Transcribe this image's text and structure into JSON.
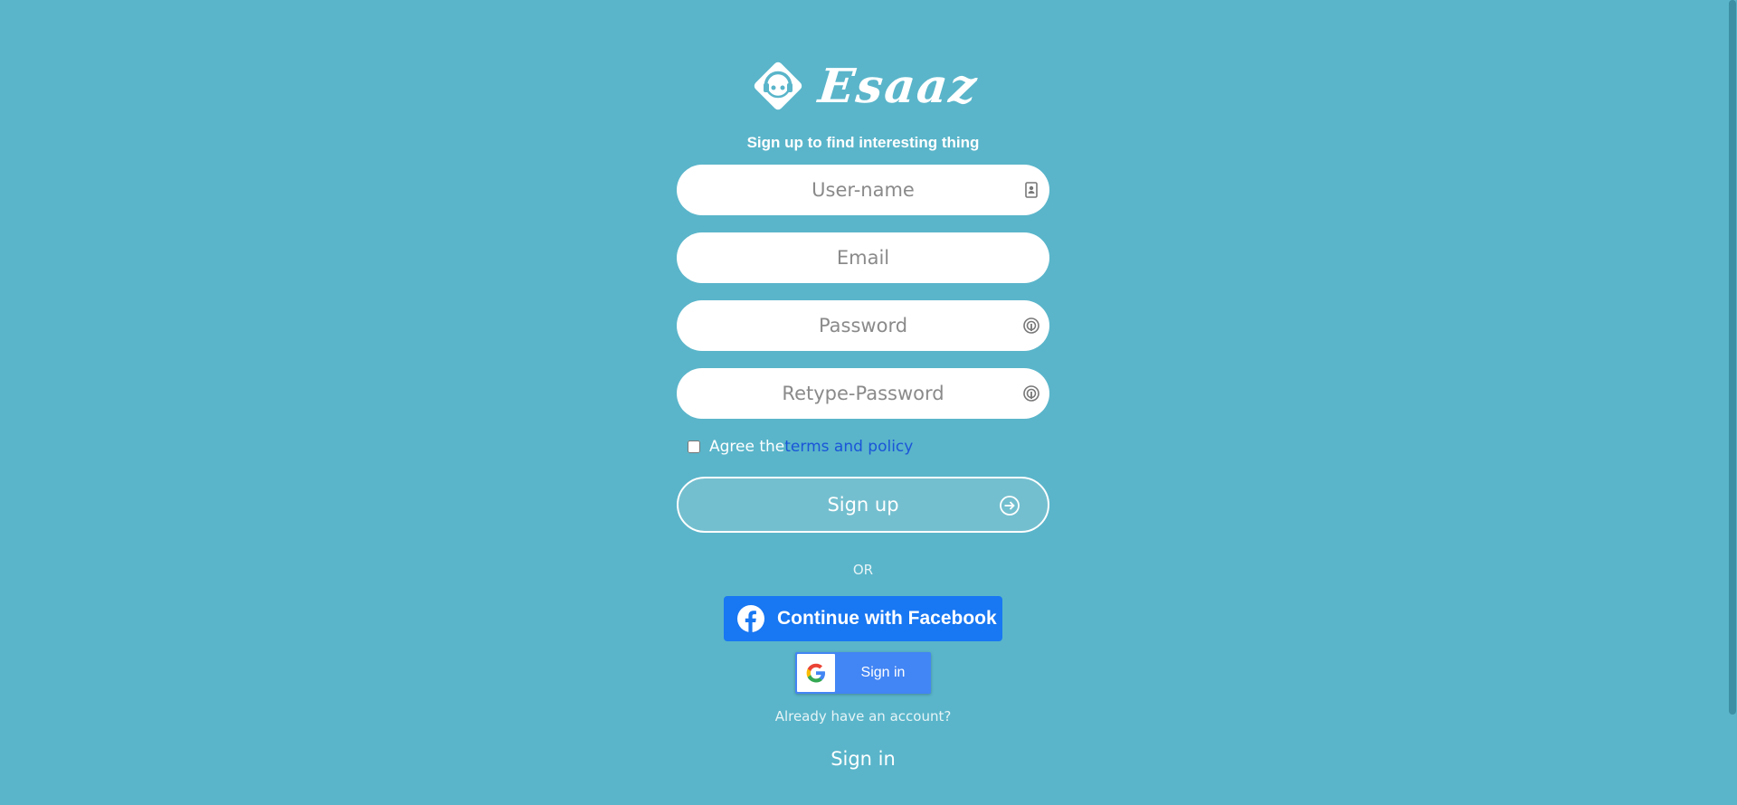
{
  "colors": {
    "background": "#5ab5ca",
    "link": "#1a55d8",
    "facebook": "#1877f2",
    "google": "#4285f4"
  },
  "brand": {
    "logo_icon": "headphone-face-icon",
    "name": "Esaaz"
  },
  "tagline": "Sign up to find interesting thing",
  "form": {
    "username": {
      "placeholder": "User-name",
      "value": "",
      "icon": "contact-card-icon"
    },
    "email": {
      "placeholder": "Email",
      "value": ""
    },
    "password": {
      "placeholder": "Password",
      "value": "",
      "icon": "fingerprint-icon"
    },
    "retype_password": {
      "placeholder": "Retype-Password",
      "value": "",
      "icon": "fingerprint-icon"
    },
    "agree": {
      "label": "Agree the",
      "link_text": "terms and policy",
      "checked": false
    },
    "submit": {
      "label": "Sign up",
      "icon": "arrow-right-circle-icon"
    }
  },
  "divider": "OR",
  "social": {
    "facebook_label": "Continue with Facebook",
    "google_label": "Sign in"
  },
  "footer": {
    "prompt": "Already have an account?",
    "signin_label": "Sign in"
  }
}
